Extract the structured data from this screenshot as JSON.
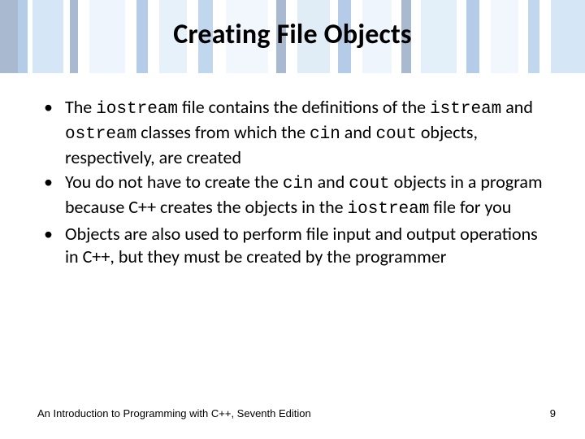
{
  "slide": {
    "title": "Creating File Objects",
    "bullets": [
      {
        "segments": [
          {
            "t": "The "
          },
          {
            "t": "iostream",
            "code": true
          },
          {
            "t": " file contains the definitions of the "
          },
          {
            "t": "istream",
            "code": true
          },
          {
            "t": " and "
          },
          {
            "t": "ostream",
            "code": true
          },
          {
            "t": " classes from which the "
          },
          {
            "t": "cin",
            "code": true
          },
          {
            "t": " and "
          },
          {
            "t": "cout",
            "code": true
          },
          {
            "t": " objects, respectively, are created"
          }
        ]
      },
      {
        "segments": [
          {
            "t": "You do not have to create the "
          },
          {
            "t": "cin",
            "code": true
          },
          {
            "t": " and "
          },
          {
            "t": "cout",
            "code": true
          },
          {
            "t": " objects in a program because C++ creates the objects in the "
          },
          {
            "t": "iostream",
            "code": true
          },
          {
            "t": " file for you"
          }
        ]
      },
      {
        "segments": [
          {
            "t": "Objects are also used to perform file input and output operations in C++, but they must be created by the programmer"
          }
        ]
      }
    ],
    "footer_left": "An Introduction to Programming with C++, Seventh Edition",
    "footer_right": "9"
  }
}
